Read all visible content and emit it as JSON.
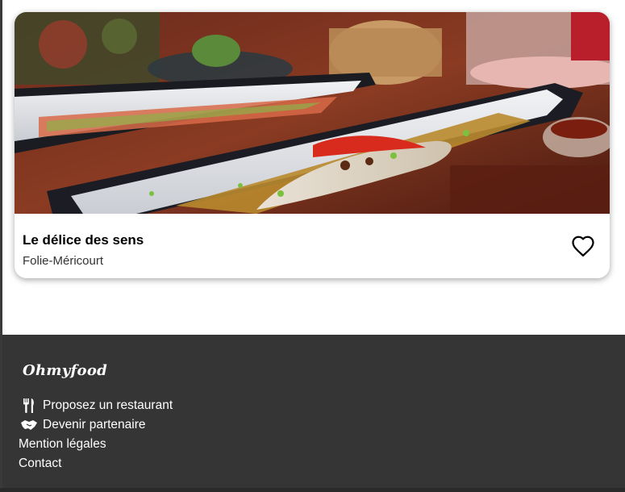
{
  "card": {
    "title": "Le délice des sens",
    "location": "Folie-Méricourt",
    "favorite_icon": "heart-outline-icon",
    "image": "photo of plated fish dishes on a restaurant table"
  },
  "footer": {
    "brand": "Ohmyfood",
    "links": [
      {
        "icon": "utensils-icon",
        "label": "Proposez un restaurant"
      },
      {
        "icon": "handshake-icon",
        "label": "Devenir partenaire"
      },
      {
        "icon": "",
        "label": "Mention légales"
      },
      {
        "icon": "",
        "label": "Contact"
      }
    ]
  },
  "colors": {
    "footer_bg": "#353535",
    "card_bg": "#ffffff",
    "text_dark": "#000000"
  }
}
